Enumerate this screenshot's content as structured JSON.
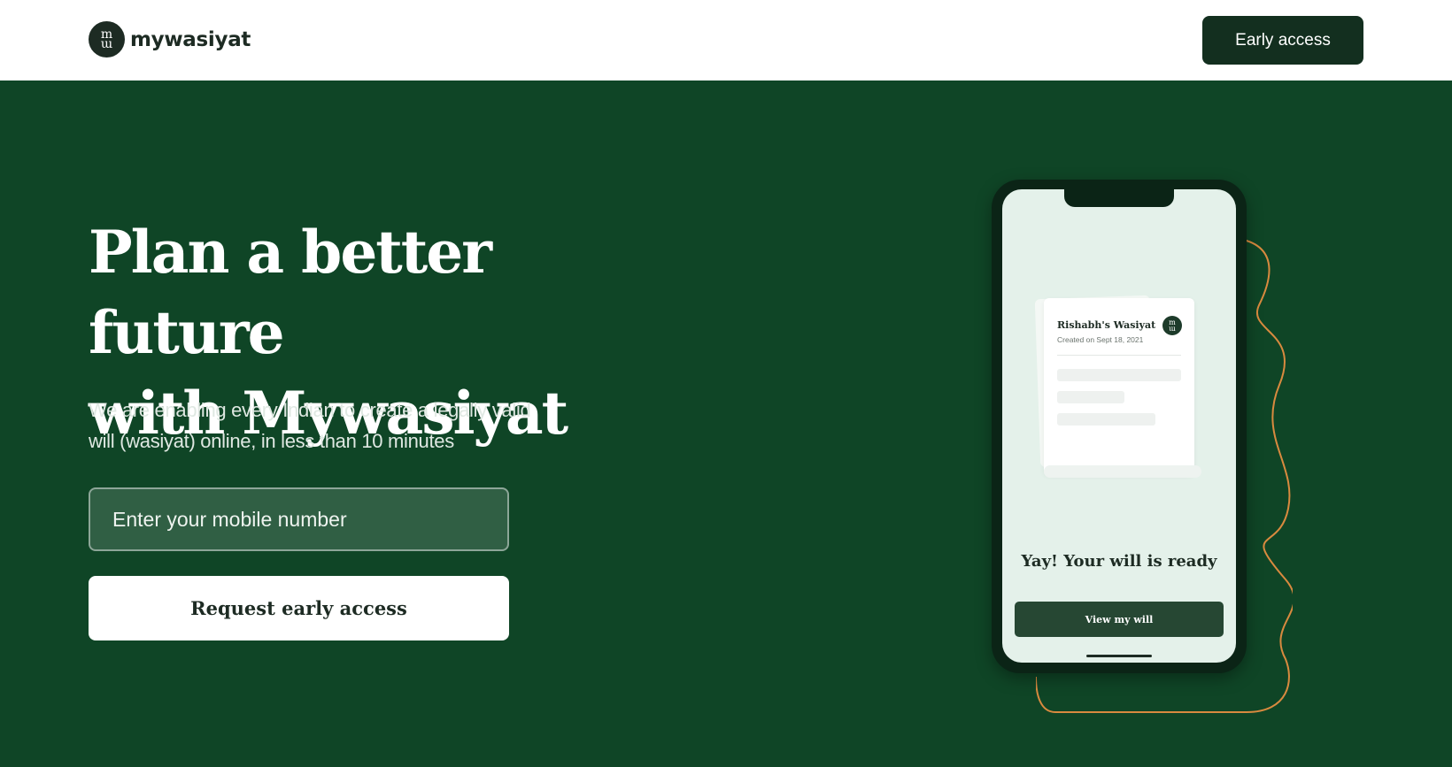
{
  "header": {
    "logo_mark_top": "m",
    "logo_mark_bottom": "ɯ",
    "brand": "mywasiyat",
    "early_access_label": "Early access"
  },
  "hero": {
    "title_line1": "Plan a better future",
    "title_line2": "with Mywasiyat",
    "subtitle_line1": "We are enabling every Indian to create a legally valid",
    "subtitle_line2": "will (wasiyat) online, in less than 10 minutes",
    "mobile_placeholder": "Enter your mobile number",
    "request_label": "Request early access"
  },
  "phone_mockup": {
    "doc_title": "Rishabh's Wasiyat",
    "doc_date": "Created on Sept 18, 2021",
    "ready_text": "Yay! Your will is ready",
    "view_label": "View my will"
  },
  "colors": {
    "background": "#0f4526",
    "header_bg": "#ffffff",
    "primary_dark": "#132f1f",
    "accent_wave": "#d98a3f",
    "screen_bg": "#e4f1ea"
  }
}
